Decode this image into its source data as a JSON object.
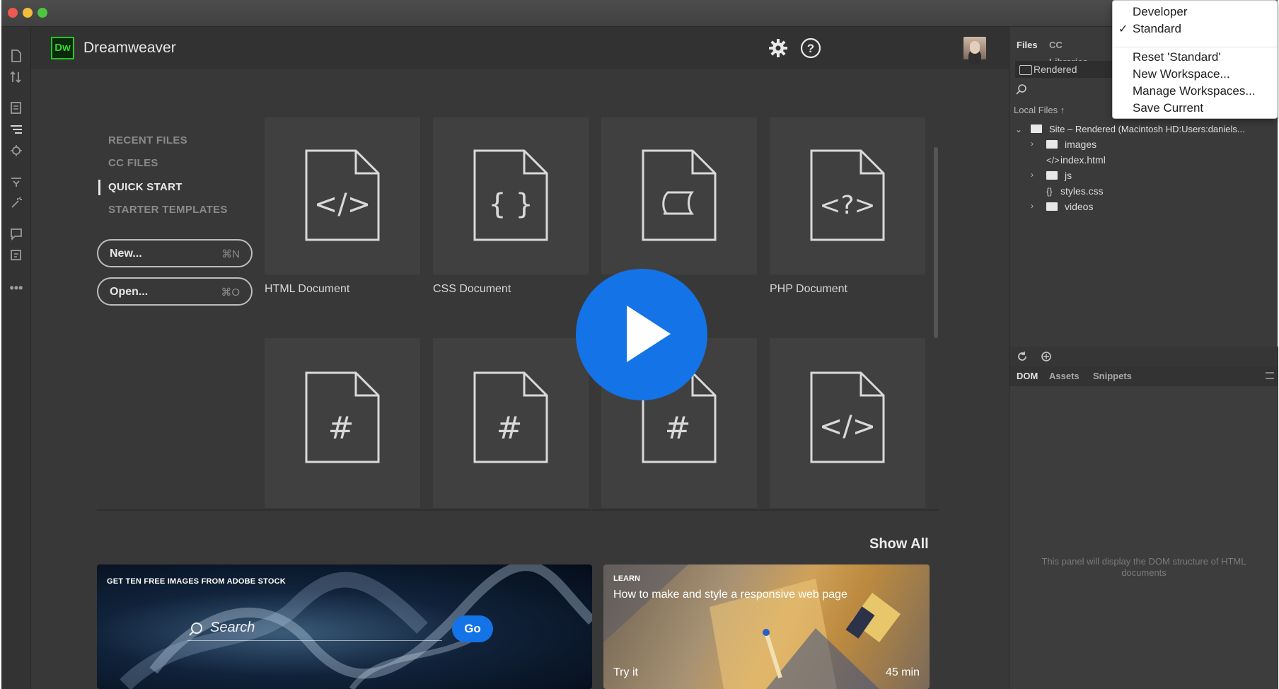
{
  "app": {
    "title": "Dreamweaver",
    "logo": "Dw"
  },
  "nav": {
    "items": [
      "RECENT FILES",
      "CC FILES",
      "QUICK START",
      "STARTER TEMPLATES"
    ],
    "active_index": 2,
    "new_label": "New...",
    "new_shortcut": "⌘N",
    "open_label": "Open...",
    "open_shortcut": "⌘O"
  },
  "cards": {
    "row1": [
      {
        "label": "HTML Document",
        "icon": "html-code-icon",
        "glyph": "</>"
      },
      {
        "label": "CSS Document",
        "icon": "css-braces-icon",
        "glyph": "{ }"
      },
      {
        "label": "",
        "icon": "script-scroll-icon",
        "glyph": ""
      },
      {
        "label": "PHP Document",
        "icon": "php-code-icon",
        "glyph": "<?>"
      }
    ],
    "row2": [
      {
        "icon": "hash-icon",
        "glyph": "#"
      },
      {
        "icon": "hash-icon",
        "glyph": "#"
      },
      {
        "icon": "hash-icon",
        "glyph": "#"
      },
      {
        "icon": "html-code-icon",
        "glyph": "</>"
      }
    ]
  },
  "show_all": "Show All",
  "stock_banner": {
    "title": "GET TEN FREE IMAGES FROM ADOBE STOCK",
    "search_placeholder": "Search",
    "go_label": "Go"
  },
  "learn_banner": {
    "kicker": "LEARN",
    "title": "How to make and style a responsive web page",
    "cta": "Try it",
    "duration": "45 min"
  },
  "files_panel": {
    "tabs": [
      "Files",
      "CC Libraries"
    ],
    "site_select": "Rendered",
    "local_files_label": "Local Files ↑",
    "site_root": "Site – Rendered (Macintosh HD:Users:daniels...",
    "items": [
      {
        "name": "images",
        "type": "folder"
      },
      {
        "name": "index.html",
        "type": "html"
      },
      {
        "name": "js",
        "type": "folder"
      },
      {
        "name": "styles.css",
        "type": "css"
      },
      {
        "name": "videos",
        "type": "folder"
      }
    ]
  },
  "dom_panel": {
    "tabs": [
      "DOM",
      "Assets",
      "Snippets"
    ],
    "empty_text": "This panel will display the DOM structure of HTML documents"
  },
  "workspace_menu": {
    "items": [
      "Developer",
      "Standard"
    ],
    "checked": "Standard",
    "actions": [
      "Reset 'Standard'",
      "New Workspace...",
      "Manage Workspaces...",
      "Save Current"
    ]
  },
  "colors": {
    "accent_blue": "#1473e6",
    "dw_green": "#22c922",
    "bg_dark": "#383838"
  }
}
